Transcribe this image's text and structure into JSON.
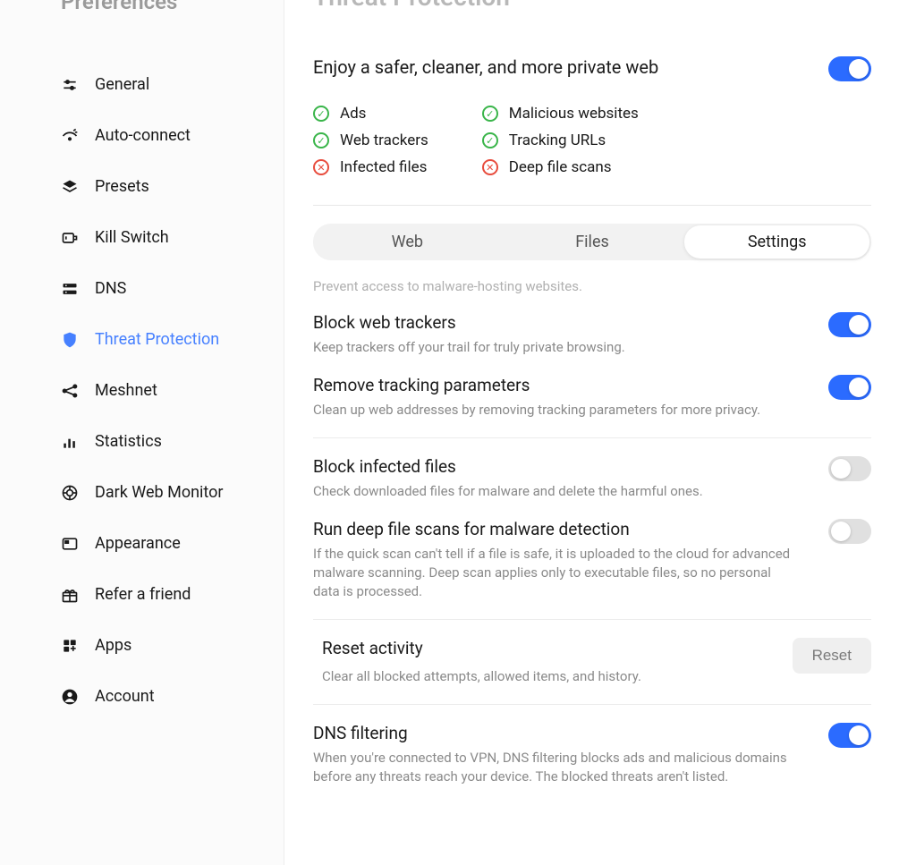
{
  "sidebar": {
    "title": "Preferences",
    "items": [
      {
        "id": "general",
        "label": "General",
        "active": false
      },
      {
        "id": "auto-connect",
        "label": "Auto-connect",
        "active": false
      },
      {
        "id": "presets",
        "label": "Presets",
        "active": false
      },
      {
        "id": "kill-switch",
        "label": "Kill Switch",
        "active": false
      },
      {
        "id": "dns",
        "label": "DNS",
        "active": false
      },
      {
        "id": "threat-protection",
        "label": "Threat Protection",
        "active": true
      },
      {
        "id": "meshnet",
        "label": "Meshnet",
        "active": false
      },
      {
        "id": "statistics",
        "label": "Statistics",
        "active": false
      },
      {
        "id": "dark-web-monitor",
        "label": "Dark Web Monitor",
        "active": false
      },
      {
        "id": "appearance",
        "label": "Appearance",
        "active": false
      },
      {
        "id": "refer-a-friend",
        "label": "Refer a friend",
        "active": false
      },
      {
        "id": "apps",
        "label": "Apps",
        "active": false
      },
      {
        "id": "account",
        "label": "Account",
        "active": false
      }
    ]
  },
  "main": {
    "page_title": "Threat Protection",
    "hero_text": "Enjoy a safer, cleaner, and more private web",
    "hero_toggle": true,
    "status": {
      "col1": [
        {
          "ok": true,
          "label": "Ads"
        },
        {
          "ok": true,
          "label": "Web trackers"
        },
        {
          "ok": false,
          "label": "Infected files"
        }
      ],
      "col2": [
        {
          "ok": true,
          "label": "Malicious websites"
        },
        {
          "ok": true,
          "label": "Tracking URLs"
        },
        {
          "ok": false,
          "label": "Deep file scans"
        }
      ]
    },
    "tabs": [
      {
        "label": "Web",
        "active": false
      },
      {
        "label": "Files",
        "active": false
      },
      {
        "label": "Settings",
        "active": true
      }
    ],
    "faded_note": "Prevent access to malware-hosting websites.",
    "settings": [
      {
        "title": "Block web trackers",
        "desc": "Keep trackers off your trail for truly private browsing.",
        "toggle": true
      },
      {
        "title": "Remove tracking parameters",
        "desc": "Clean up web addresses by removing tracking parameters for more privacy.",
        "toggle": true
      },
      {
        "title": "Block infected files",
        "desc": "Check downloaded files for malware and delete the harmful ones.",
        "toggle": false
      },
      {
        "title": "Run deep file scans for malware detection",
        "desc": "If the quick scan can't tell if a file is safe, it is uploaded to the cloud for advanced malware scanning. Deep scan applies only to executable files, so no personal data is processed.",
        "toggle": false
      }
    ],
    "reset": {
      "title": "Reset activity",
      "desc": "Clear all blocked attempts, allowed items, and history.",
      "button": "Reset"
    },
    "dns_filtering": {
      "title": "DNS filtering",
      "desc": "When you're connected to VPN, DNS filtering blocks ads and malicious domains before any threats reach your device. The blocked threats aren't listed.",
      "toggle": true
    }
  }
}
